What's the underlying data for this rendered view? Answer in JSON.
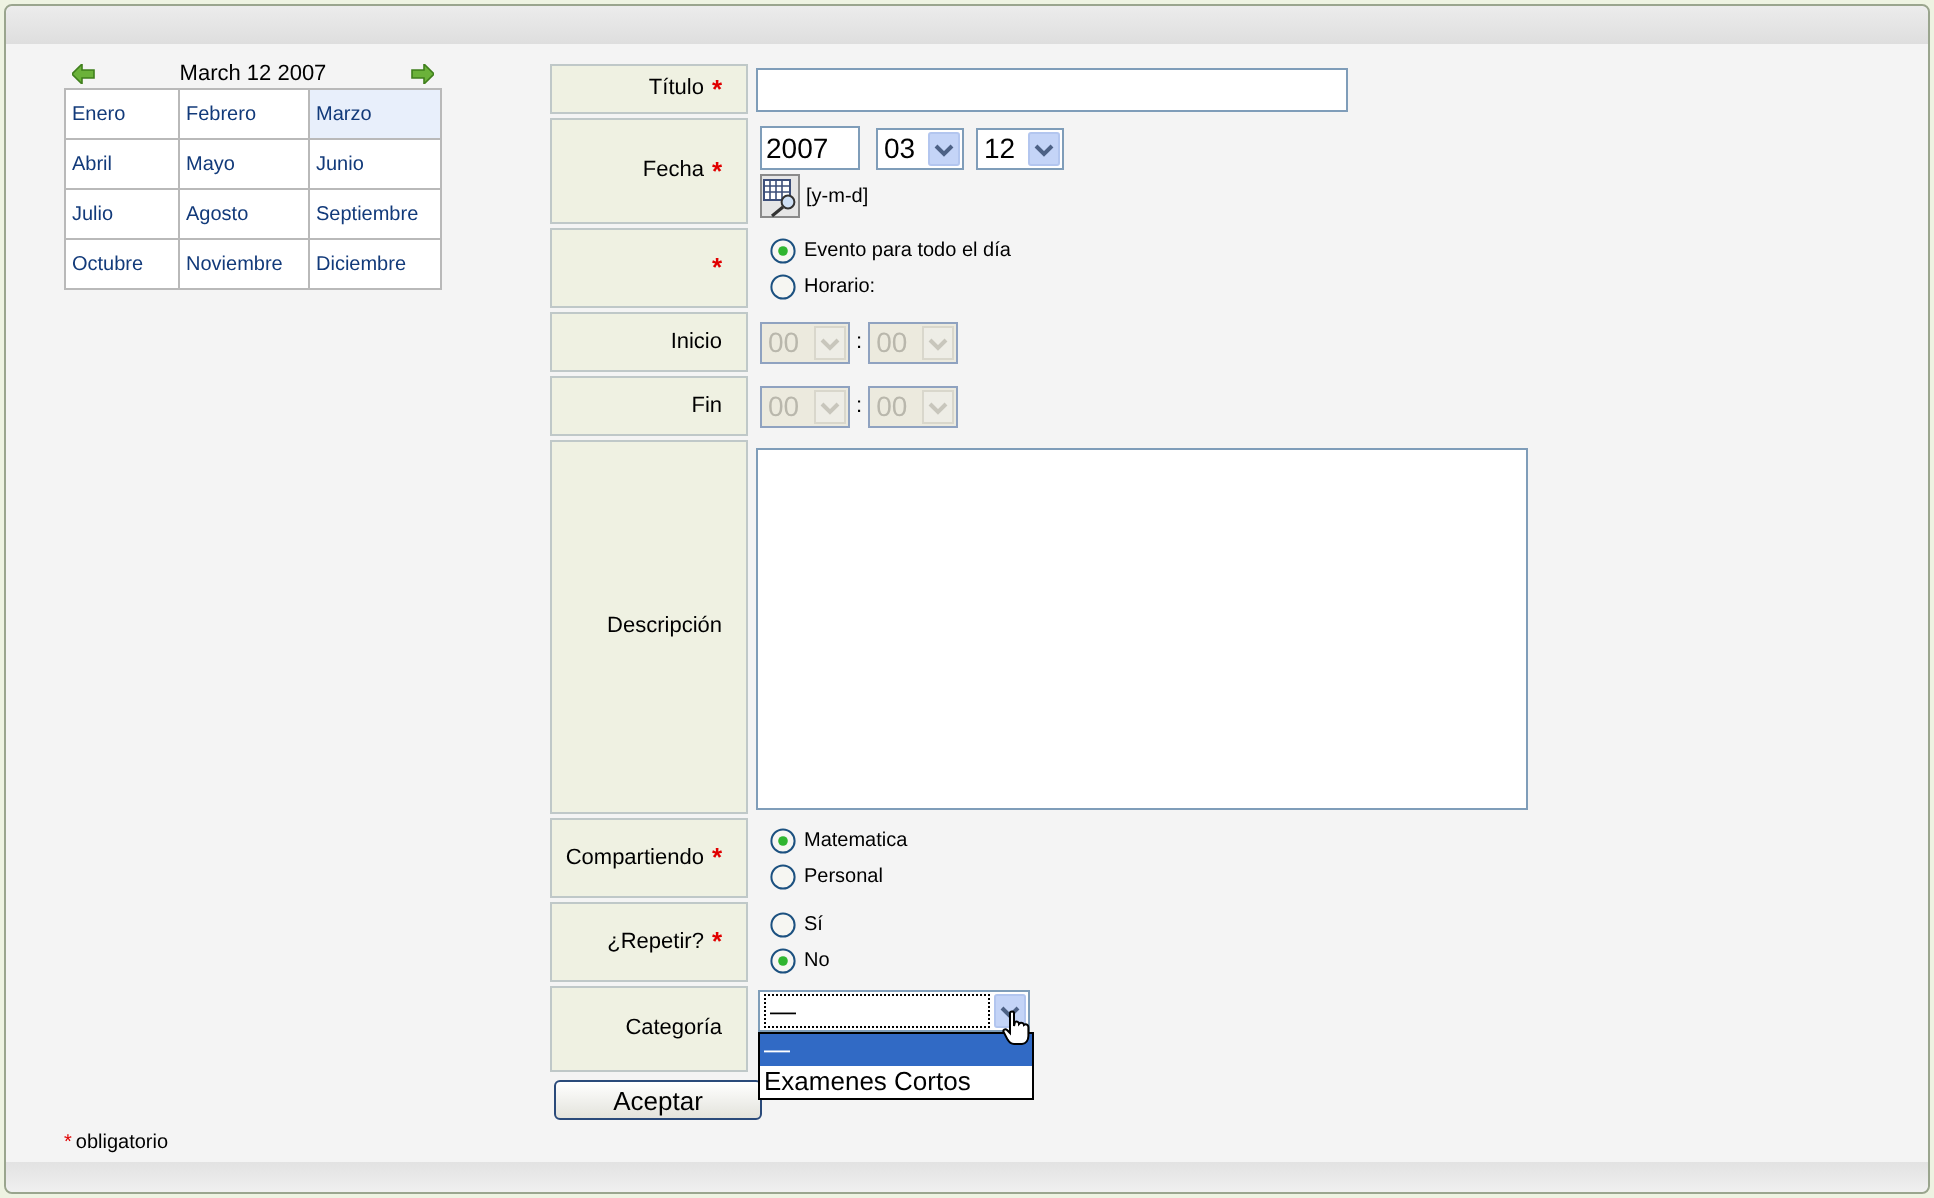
{
  "calendar": {
    "title": "March 12 2007",
    "months": [
      {
        "label": "Enero",
        "selected": false
      },
      {
        "label": "Febrero",
        "selected": false
      },
      {
        "label": "Marzo",
        "selected": true
      },
      {
        "label": "Abril",
        "selected": false
      },
      {
        "label": "Mayo",
        "selected": false
      },
      {
        "label": "Junio",
        "selected": false
      },
      {
        "label": "Julio",
        "selected": false
      },
      {
        "label": "Agosto",
        "selected": false
      },
      {
        "label": "Septiembre",
        "selected": false
      },
      {
        "label": "Octubre",
        "selected": false
      },
      {
        "label": "Noviembre",
        "selected": false
      },
      {
        "label": "Diciembre",
        "selected": false
      }
    ]
  },
  "form": {
    "rows": [
      {
        "kind": "text",
        "label": "Título",
        "required_mark": "*",
        "value": ""
      },
      {
        "kind": "date",
        "label": "Fecha",
        "required_mark": "*",
        "year": "2007",
        "month": "03",
        "day": "12",
        "format": "[y-m-d]"
      },
      {
        "kind": "radio",
        "label": "",
        "required_mark": "*",
        "options": [
          {
            "label": "Evento para todo el día",
            "selected": true
          },
          {
            "label": "Horario:",
            "selected": false
          }
        ]
      },
      {
        "kind": "time",
        "label": "Inicio",
        "hour": "00",
        "minute": "00",
        "separator": ":",
        "disabled": true
      },
      {
        "kind": "time",
        "label": "Fin",
        "hour": "00",
        "minute": "00",
        "separator": ":",
        "disabled": true
      },
      {
        "kind": "textarea",
        "label": "Descripción",
        "value": ""
      },
      {
        "kind": "radio",
        "label": "Compartiendo",
        "required_mark": "*",
        "options": [
          {
            "label": "Matematica",
            "selected": true
          },
          {
            "label": "Personal",
            "selected": false
          }
        ]
      },
      {
        "kind": "radio",
        "label": "¿Repetir?",
        "required_mark": "*",
        "options": [
          {
            "label": "Sí",
            "selected": false
          },
          {
            "label": "No",
            "selected": true
          }
        ]
      },
      {
        "kind": "select",
        "label": "Categoría",
        "value": "—",
        "open": true,
        "options": [
          {
            "label": "—",
            "selected": true
          },
          {
            "label": "Examenes Cortos",
            "selected": false
          }
        ]
      }
    ],
    "submit": "Aceptar"
  },
  "footnote": {
    "mark": "*",
    "text": "obligatorio"
  }
}
